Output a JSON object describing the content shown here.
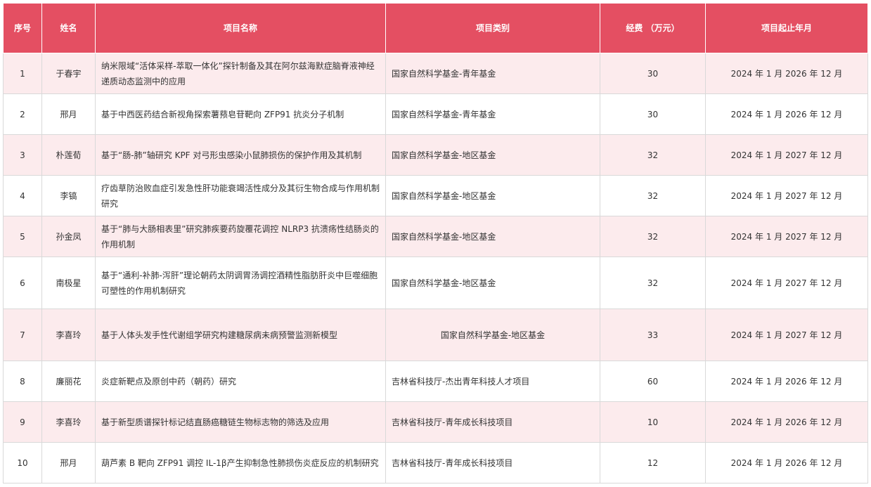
{
  "header": {
    "no": "序号",
    "name": "姓名",
    "title": "项目名称",
    "category": "项目类别",
    "funding": "经费 （万元）",
    "period": "项目起止年月"
  },
  "rows": [
    {
      "no": "1",
      "name": "于春宇",
      "title": "纳米限域“活体采样-萃取一体化”探针制备及其在阿尔兹海默症脑脊液神经递质动态监测中的应用",
      "category": "国家自然科学基金-青年基金",
      "funding": "30",
      "period": "2024 年 1 月 2026 年 12 月"
    },
    {
      "no": "2",
      "name": "邢月",
      "title": "基于中西医药结合新视角探索薯蓣皂苷靶向 ZFP91 抗炎分子机制",
      "category": "国家自然科学基金-青年基金",
      "funding": "30",
      "period": "2024 年 1 月 2026 年 12 月"
    },
    {
      "no": "3",
      "name": "朴莲荀",
      "title": "基于“肠-肺”轴研究 KPF 对弓形虫感染小鼠肺损伤的保护作用及其机制",
      "category": "国家自然科学基金-地区基金",
      "funding": "32",
      "period": "2024 年 1 月 2027 年 12 月"
    },
    {
      "no": "4",
      "name": "李镐",
      "title": "疗齿草防治败血症引发急性肝功能衰竭活性成分及其衍生物合成与作用机制研究",
      "category": "国家自然科学基金-地区基金",
      "funding": "32",
      "period": "2024 年 1 月 2027 年 12 月"
    },
    {
      "no": "5",
      "name": "孙金凤",
      "title": "基于“肺与大肠相表里”研究肺疾要药旋覆花调控 NLRP3 抗溃疡性结肠炎的作用机制",
      "category": "国家自然科学基金-地区基金",
      "funding": "32",
      "period": "2024 年 1 月 2027 年 12 月"
    },
    {
      "no": "6",
      "name": "南极星",
      "title": "基于“通利-补肺-泻肝”理论朝药太阴调胃汤调控酒精性脂肪肝炎中巨噬细胞可塑性的作用机制研究",
      "category": "国家自然科学基金-地区基金",
      "funding": "32",
      "period": "2024 年 1 月 2027 年 12 月"
    },
    {
      "no": "7",
      "name": "李喜玲",
      "title": "基于人体头发手性代谢组学研究构建糖尿病未病预警监测新模型",
      "category": "国家自然科学基金-地区基金",
      "funding": "33",
      "period": "2024 年 1 月 2027 年 12 月"
    },
    {
      "no": "8",
      "name": "廉丽花",
      "title": "炎症新靶点及原创中药（朝药）研究",
      "category": "吉林省科技厅-杰出青年科技人才项目",
      "funding": "60",
      "period": "2024 年 1 月 2026 年 12 月"
    },
    {
      "no": "9",
      "name": "李喜玲",
      "title": "基于新型质谱探针标记结直肠癌糖链生物标志物的筛选及应用",
      "category": "吉林省科技厅-青年成长科技项目",
      "funding": "10",
      "period": "2024 年 1 月 2026 年 12 月"
    },
    {
      "no": "10",
      "name": "邢月",
      "title": "葫芦素 B 靶向 ZFP91 调控 IL-1β产生抑制急性肺损伤炎症反应的机制研究",
      "category": "吉林省科技厅-青年成长科技项目",
      "funding": "12",
      "period": "2024 年 1 月 2026 年 12 月"
    }
  ],
  "colors": {
    "header_bg": "#e44f62",
    "stripe_bg": "#fcebed"
  }
}
